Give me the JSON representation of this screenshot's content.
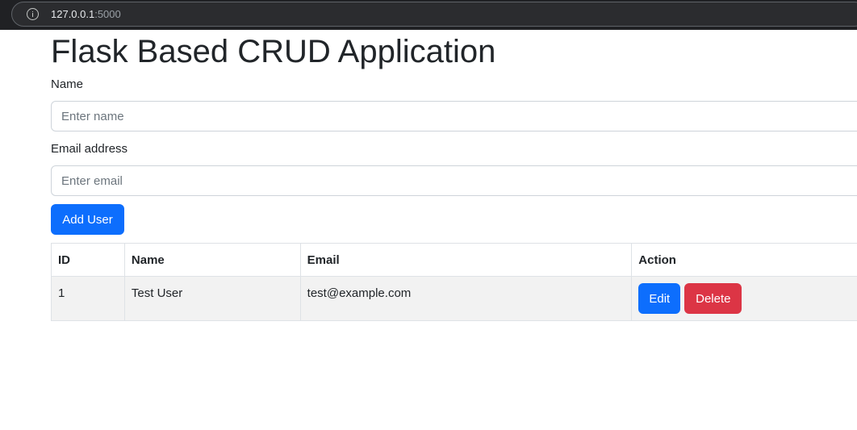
{
  "browser": {
    "url_host": "127.0.0.1",
    "url_port": ":5000"
  },
  "page": {
    "title": "Flask Based CRUD Application"
  },
  "form": {
    "name_label": "Name",
    "name_placeholder": "Enter name",
    "name_value": "",
    "email_label": "Email address",
    "email_placeholder": "Enter email",
    "email_value": "",
    "add_button": "Add User"
  },
  "table": {
    "headers": [
      "ID",
      "Name",
      "Email",
      "Action"
    ],
    "rows": [
      {
        "id": "1",
        "name": "Test User",
        "email": "test@example.com",
        "edit_label": "Edit",
        "delete_label": "Delete"
      }
    ]
  },
  "colors": {
    "primary": "#0d6efd",
    "danger": "#dc3545",
    "row_background": "#f2f2f2"
  }
}
